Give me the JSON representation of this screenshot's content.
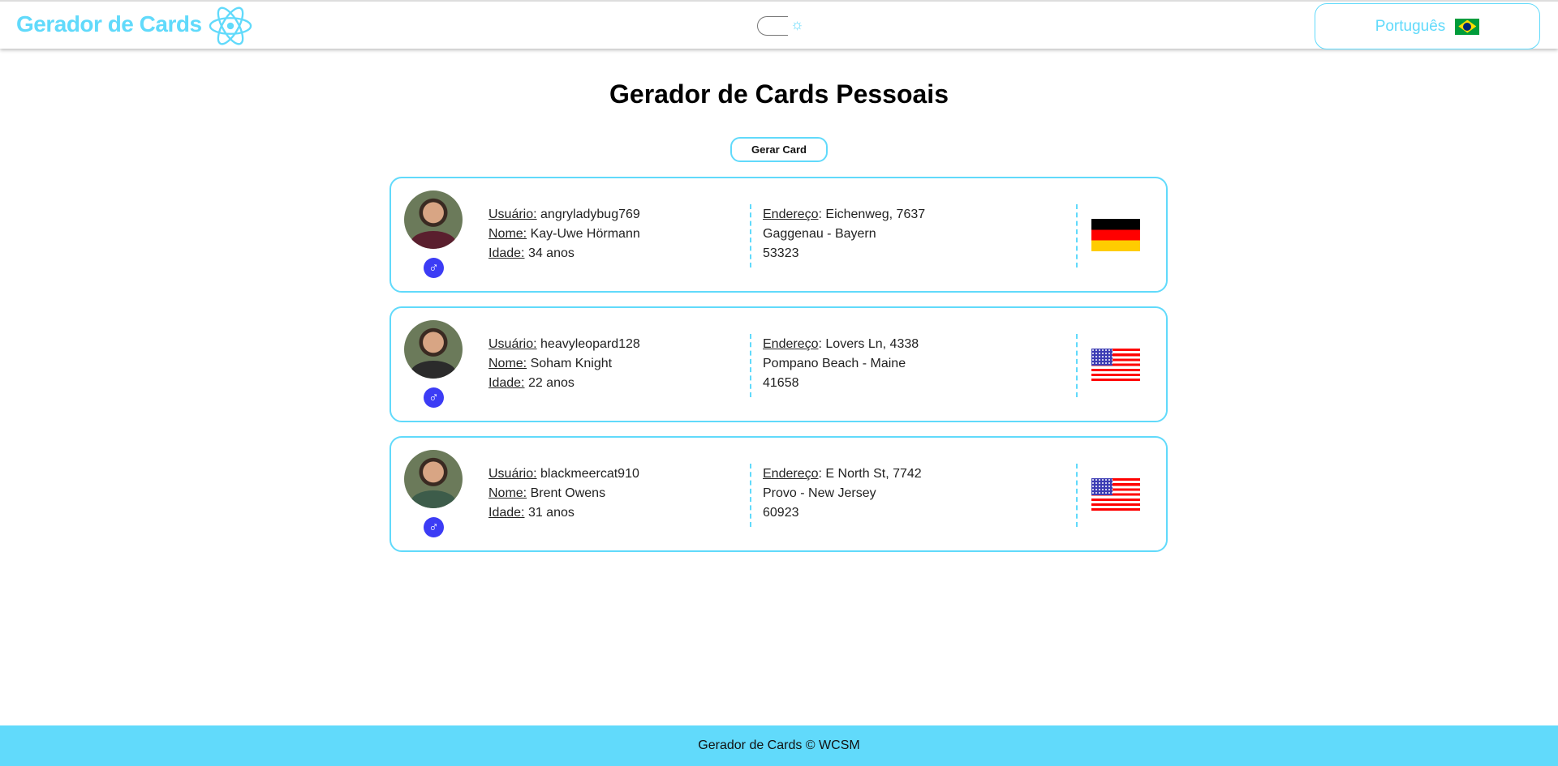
{
  "header": {
    "brand": "Gerador de Cards",
    "language": "Português",
    "theme_icon": "sun-icon",
    "language_flag": "brazil-flag"
  },
  "page": {
    "title": "Gerador de Cards Pessoais",
    "generate_button": "Gerar Card"
  },
  "labels": {
    "user": "Usuário:",
    "name": "Nome:",
    "age": "Idade:",
    "address": "Endereço"
  },
  "cards": [
    {
      "username": "angryladybug769",
      "name": "Kay-Uwe Hörmann",
      "age": "34 anos",
      "street": ": Eichenweg, 7637",
      "city": "Gaggenau - Bayern",
      "postcode": "53323",
      "gender": "♂",
      "flag": "germany",
      "body_color": "#5a1f2e"
    },
    {
      "username": "heavyleopard128",
      "name": "Soham Knight",
      "age": "22 anos",
      "street": ": Lovers Ln, 4338",
      "city": "Pompano Beach - Maine",
      "postcode": "41658",
      "gender": "♂",
      "flag": "usa",
      "body_color": "#2b2b2b"
    },
    {
      "username": "blackmeercat910",
      "name": "Brent Owens",
      "age": "31 anos",
      "street": ": E North St, 7742",
      "city": "Provo - New Jersey",
      "postcode": "60923",
      "gender": "♂",
      "flag": "usa",
      "body_color": "#3d5c4a"
    }
  ],
  "footer": {
    "text": "Gerador de Cards © WCSM"
  }
}
